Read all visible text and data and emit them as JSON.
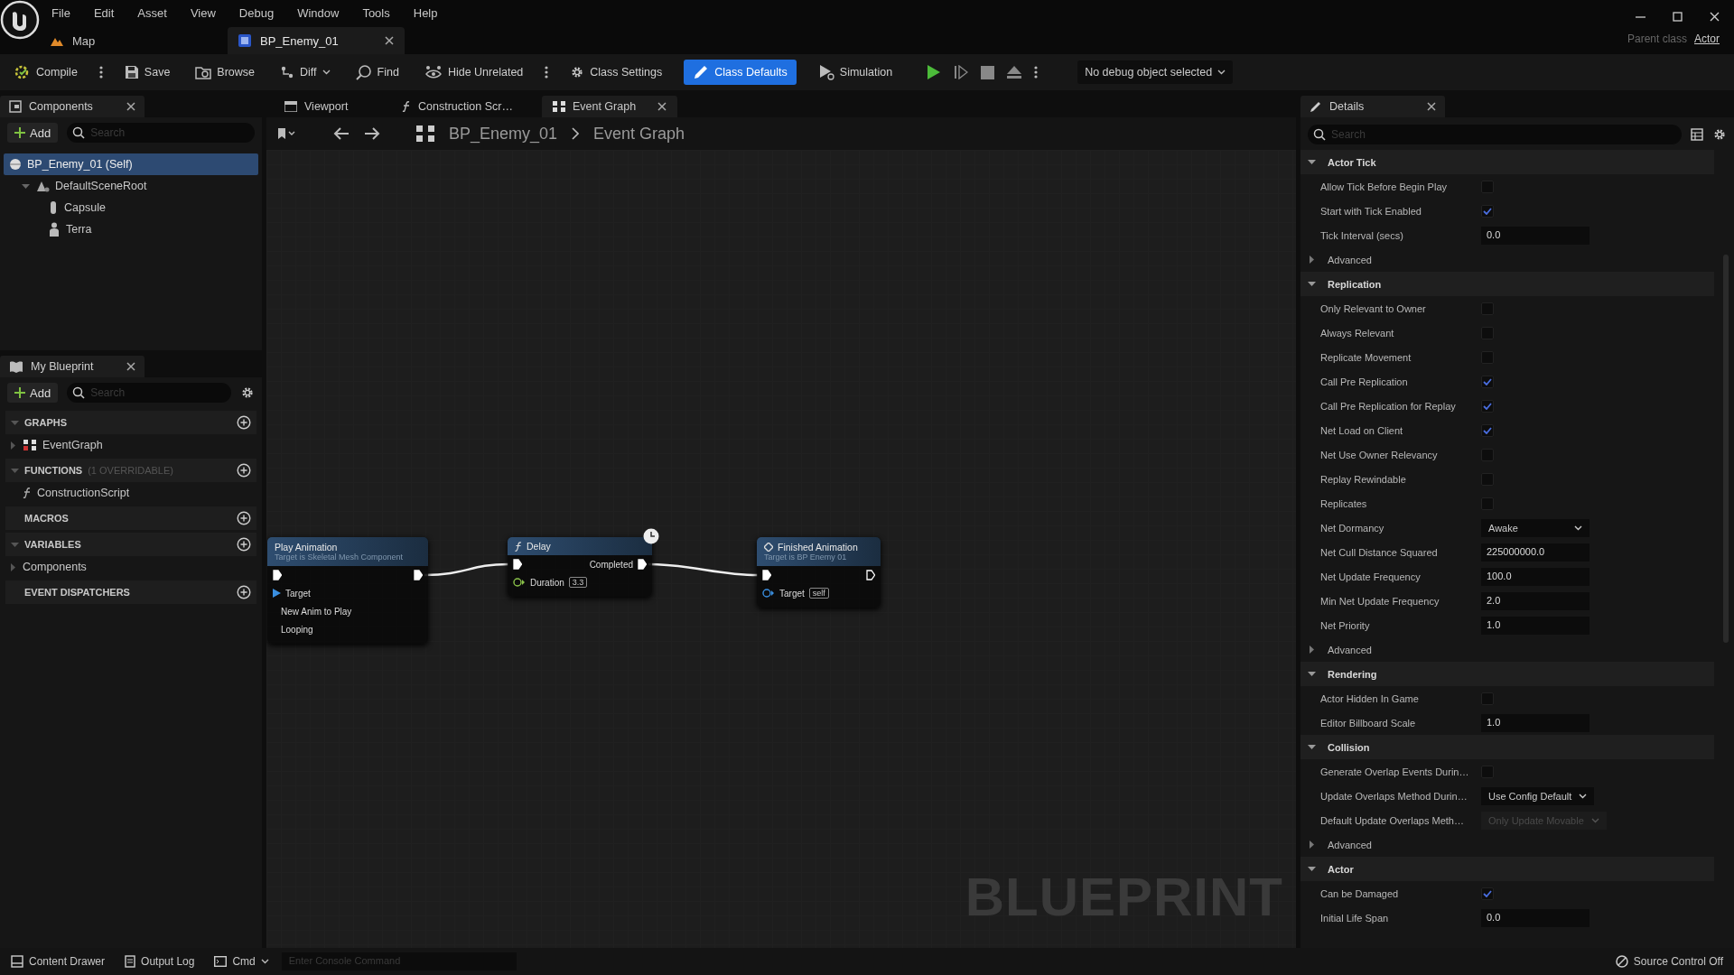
{
  "menu": [
    "File",
    "Edit",
    "Asset",
    "View",
    "Debug",
    "Window",
    "Tools",
    "Help"
  ],
  "doc_tabs": [
    {
      "label": "Map",
      "selected": false
    },
    {
      "label": "BP_Enemy_01",
      "selected": true
    }
  ],
  "parent_class": {
    "label": "Parent class",
    "value": "Actor"
  },
  "toolbar": {
    "items": [
      {
        "kind": "button",
        "label": "Compile",
        "selected": false
      },
      {
        "kind": "more"
      },
      {
        "kind": "button",
        "label": "Save",
        "selected": false
      },
      {
        "kind": "button",
        "label": "Browse",
        "selected": false
      },
      {
        "kind": "dropdown",
        "label": "Diff",
        "selected": false
      },
      {
        "kind": "button",
        "label": "Find",
        "selected": false
      },
      {
        "kind": "button",
        "label": "Hide Unrelated",
        "selected": false
      },
      {
        "kind": "more"
      },
      {
        "kind": "button",
        "label": "Class Settings",
        "selected": false
      },
      {
        "kind": "button",
        "label": "Class Defaults",
        "selected": true
      },
      {
        "kind": "button",
        "label": "Simulation",
        "selected": false
      }
    ],
    "debug_object": "No debug object selected"
  },
  "components": {
    "title": "Components",
    "add": "Add",
    "search_placeholder": "Search",
    "tree": [
      {
        "label": "BP_Enemy_01 (Self)",
        "selected": true,
        "children": [
          {
            "label": "DefaultSceneRoot",
            "selected": false,
            "expanded": true,
            "children": [
              {
                "label": "Capsule",
                "selected": false
              },
              {
                "label": "Terra",
                "selected": false
              }
            ]
          }
        ]
      }
    ]
  },
  "my_blueprint": {
    "title": "My Blueprint",
    "add": "Add",
    "search_placeholder": "Search",
    "sections": [
      {
        "title": "GRAPHS",
        "expanded": true,
        "items": [
          {
            "label": "EventGraph",
            "expanded": false
          }
        ]
      },
      {
        "title": "FUNCTIONS",
        "note": "(1 OVERRIDABLE)",
        "expanded": true,
        "items": [
          {
            "label": "ConstructionScript"
          }
        ]
      },
      {
        "title": "MACROS"
      },
      {
        "title": "VARIABLES",
        "expanded": true,
        "items": [
          {
            "label": "Components",
            "expanded": false
          }
        ]
      },
      {
        "title": "EVENT DISPATCHERS"
      }
    ]
  },
  "graph": {
    "tabs": [
      {
        "label": "Viewport",
        "selected": false
      },
      {
        "label": "Construction Scr…",
        "selected": false
      },
      {
        "label": "Event Graph",
        "selected": true
      }
    ],
    "breadcrumb": [
      "BP_Enemy_01",
      "Event Graph"
    ],
    "nodes": [
      {
        "kind": "function",
        "title": "Play Animation",
        "subtitle": "Target is Skeletal Mesh Component",
        "rows": [
          {
            "left": {
              "kind": "exec",
              "connected": true
            },
            "right": {
              "kind": "exec",
              "connected": true
            }
          },
          {
            "left": {
              "kind": "target",
              "label": "Target"
            }
          },
          {
            "left": {
              "kind": "label",
              "label": "New Anim to Play"
            }
          },
          {
            "left": {
              "kind": "label",
              "label": "Looping"
            }
          }
        ]
      },
      {
        "kind": "latent",
        "title": "Delay",
        "rows": [
          {
            "left": {
              "kind": "exec",
              "connected": true
            },
            "right": {
              "kind": "exec",
              "connected": true,
              "label": "Completed"
            }
          },
          {
            "left": {
              "kind": "float",
              "label": "Duration",
              "value": "3.3"
            }
          }
        ]
      },
      {
        "kind": "call",
        "title": "Finished Animation",
        "subtitle": "Target is BP Enemy 01",
        "rows": [
          {
            "left": {
              "kind": "exec",
              "connected": true
            },
            "right": {
              "kind": "exec",
              "connected": false
            }
          },
          {
            "left": {
              "kind": "object",
              "label": "Target",
              "value": "self"
            }
          }
        ]
      }
    ],
    "watermark": "BLUEPRINT"
  },
  "details": {
    "title": "Details",
    "search_placeholder": "Search",
    "sections": [
      {
        "title": "Actor Tick",
        "expanded": true,
        "rows": [
          {
            "kind": "check",
            "label": "Allow Tick Before Begin Play",
            "checked": false
          },
          {
            "kind": "check",
            "label": "Start with Tick Enabled",
            "checked": true
          },
          {
            "kind": "number",
            "label": "Tick Interval (secs)",
            "value": "0.0"
          },
          {
            "kind": "advanced",
            "label": "Advanced",
            "expanded": false
          }
        ]
      },
      {
        "title": "Replication",
        "expanded": true,
        "rows": [
          {
            "kind": "check",
            "label": "Only Relevant to Owner",
            "checked": false
          },
          {
            "kind": "check",
            "label": "Always Relevant",
            "checked": false
          },
          {
            "kind": "check",
            "label": "Replicate Movement",
            "checked": false
          },
          {
            "kind": "check",
            "label": "Call Pre Replication",
            "checked": true
          },
          {
            "kind": "check",
            "label": "Call Pre Replication for Replay",
            "checked": true
          },
          {
            "kind": "check",
            "label": "Net Load on Client",
            "checked": true
          },
          {
            "kind": "check",
            "label": "Net Use Owner Relevancy",
            "checked": false
          },
          {
            "kind": "check",
            "label": "Replay Rewindable",
            "checked": false
          },
          {
            "kind": "check",
            "label": "Replicates",
            "checked": false
          },
          {
            "kind": "dropdown",
            "label": "Net Dormancy",
            "value": "Awake",
            "disabled": false
          },
          {
            "kind": "number",
            "label": "Net Cull Distance Squared",
            "value": "225000000.0"
          },
          {
            "kind": "number",
            "label": "Net Update Frequency",
            "value": "100.0"
          },
          {
            "kind": "number",
            "label": "Min Net Update Frequency",
            "value": "2.0"
          },
          {
            "kind": "number",
            "label": "Net Priority",
            "value": "1.0"
          },
          {
            "kind": "advanced",
            "label": "Advanced",
            "expanded": false
          }
        ]
      },
      {
        "title": "Rendering",
        "expanded": true,
        "rows": [
          {
            "kind": "check",
            "label": "Actor Hidden In Game",
            "checked": false
          },
          {
            "kind": "number",
            "label": "Editor Billboard Scale",
            "value": "1.0"
          }
        ]
      },
      {
        "title": "Collision",
        "expanded": true,
        "rows": [
          {
            "kind": "check",
            "label": "Generate Overlap Events Durin…",
            "checked": false
          },
          {
            "kind": "dropdown",
            "label": "Update Overlaps Method Durin…",
            "value": "Use Config Default",
            "disabled": false
          },
          {
            "kind": "dropdown",
            "label": "Default Update Overlaps Meth…",
            "value": "Only Update Movable",
            "disabled": true
          },
          {
            "kind": "advanced",
            "label": "Advanced",
            "expanded": false
          }
        ]
      },
      {
        "title": "Actor",
        "expanded": true,
        "rows": [
          {
            "kind": "check",
            "label": "Can be Damaged",
            "checked": true
          },
          {
            "kind": "number",
            "label": "Initial Life Span",
            "value": "0.0"
          }
        ]
      }
    ]
  },
  "status_bar": {
    "buttons": [
      "Content Drawer",
      "Output Log"
    ],
    "cmd": "Cmd",
    "console_placeholder": "Enter Console Command",
    "source_control": "Source Control Off"
  }
}
